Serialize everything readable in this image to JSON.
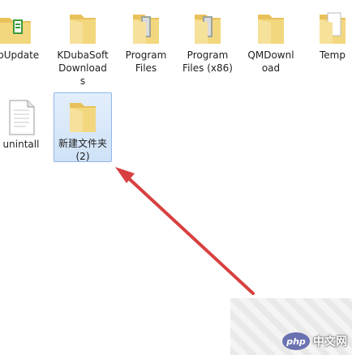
{
  "files": [
    {
      "name": "GpUpdate",
      "type": "folder-green"
    },
    {
      "name": "KDubaSoft\nDownload\ns",
      "type": "folder"
    },
    {
      "name": "Program\nFiles",
      "type": "folder"
    },
    {
      "name": "Program\nFiles (x86)",
      "type": "folder"
    },
    {
      "name": "QMDownl\noad",
      "type": "folder"
    },
    {
      "name": "Temp",
      "type": "folder-doc"
    },
    {
      "name": "unintall",
      "type": "file"
    },
    {
      "name": "新建文件夹\n(2)",
      "type": "folder",
      "selected": true
    }
  ],
  "watermark": {
    "brand": "php",
    "site": "中文网"
  },
  "colors": {
    "arrow": "#d84040",
    "selection": "#cfe2f8"
  },
  "icons": {
    "folder": "folder-icon",
    "file": "document-icon",
    "arrow": "red-arrow-icon"
  }
}
